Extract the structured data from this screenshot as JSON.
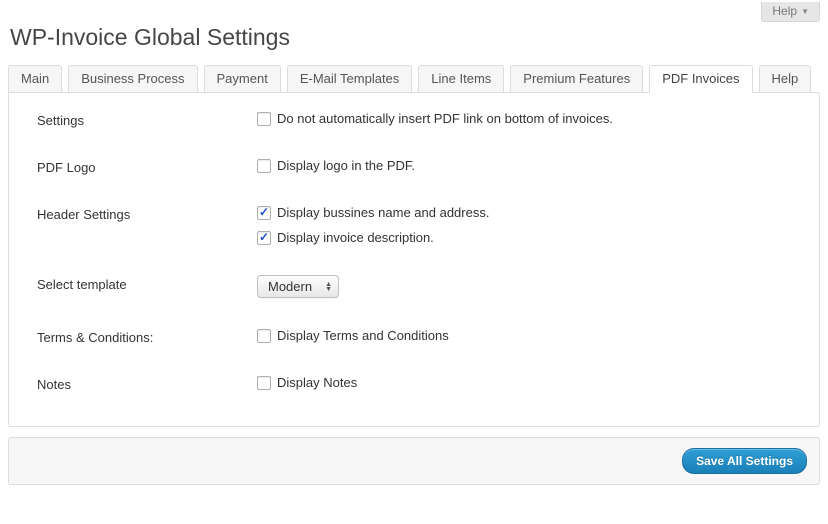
{
  "screen_options": {
    "help_label": "Help"
  },
  "page_title": "WP-Invoice Global Settings",
  "tabs": [
    {
      "label": "Main",
      "active": false
    },
    {
      "label": "Business Process",
      "active": false
    },
    {
      "label": "Payment",
      "active": false
    },
    {
      "label": "E-Mail Templates",
      "active": false
    },
    {
      "label": "Line Items",
      "active": false
    },
    {
      "label": "Premium Features",
      "active": false
    },
    {
      "label": "PDF Invoices",
      "active": true
    },
    {
      "label": "Help",
      "active": false
    }
  ],
  "sections": {
    "settings": {
      "title": "Settings",
      "fields": [
        {
          "label": "Do not automatically insert PDF link on bottom of invoices.",
          "checked": false
        }
      ]
    },
    "pdf_logo": {
      "title": "PDF Logo",
      "fields": [
        {
          "label": "Display logo in the PDF.",
          "checked": false
        }
      ]
    },
    "header_settings": {
      "title": "Header Settings",
      "fields": [
        {
          "label": "Display bussines name and address.",
          "checked": true
        },
        {
          "label": "Display invoice description.",
          "checked": true
        }
      ]
    },
    "select_template": {
      "title": "Select template",
      "value": "Modern"
    },
    "terms": {
      "title": "Terms & Conditions:",
      "fields": [
        {
          "label": "Display Terms and Conditions",
          "checked": false
        }
      ]
    },
    "notes": {
      "title": "Notes",
      "fields": [
        {
          "label": "Display Notes",
          "checked": false
        }
      ]
    }
  },
  "footer": {
    "save_label": "Save All Settings"
  }
}
